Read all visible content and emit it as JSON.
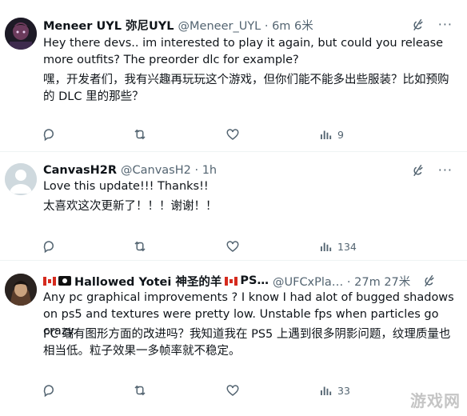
{
  "tweets": [
    {
      "display_name": "Meneer UYL 弥尼UYL",
      "handle": "@Meneer_UYL · 6m 6米",
      "text_en": "Hey there devs.. im interested to play it again, but could you release more outfits? The preorder dlc for example?",
      "text_zh": "嘿，开发者们，我有兴趣再玩玩这个游戏，但你们能不能多出些服装？比如预购的 DLC 里的那些？",
      "views": "9"
    },
    {
      "display_name": "CanvasH2R",
      "handle": "@CanvasH2 · 1h",
      "text_en": "Love this update!!! Thanks!!",
      "text_zh": "太喜欢这次更新了！！！谢谢！！",
      "views": "134"
    },
    {
      "display_name": "Hallowed Yotei 神圣的羊",
      "name_suffix": "PS…",
      "handle": "@UFCxPla… · 27m 27米",
      "text_en": "Any pc graphical improvements ? I know I had alot of bugged shadows on ps5 and textures were pretty low. Unstable fps when particles go crazy.",
      "text_zh": "PC 端有图形方面的改进吗？我知道我在 PS5 上遇到很多阴影问题，纹理质量也相当低。粒子效果一多帧率就不稳定。",
      "views": "33"
    }
  ],
  "watermark": "游戏网",
  "icons": [
    "reply-icon",
    "retweet-icon",
    "like-icon",
    "views-icon",
    "grok-icon",
    "more-icon"
  ],
  "colors": {
    "text": "#0f1419",
    "secondary": "#536471",
    "divider": "#eff3f4"
  }
}
